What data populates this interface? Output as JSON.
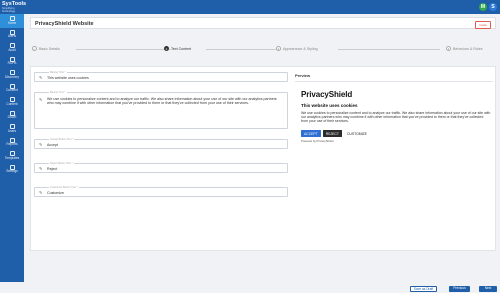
{
  "brand": {
    "name": "SysTools",
    "tagline": "Simplifying Technology"
  },
  "topbar": {
    "avatar_m": "M",
    "avatar_s": "S",
    "avatar_m_color": "#2fa84f",
    "avatar_s_color": "#2f7ad8"
  },
  "sidebar": {
    "items": [
      {
        "label": "Home",
        "icon": "home-icon",
        "active": true
      },
      {
        "label": "Alerts",
        "icon": "bell-icon"
      },
      {
        "label": "Audit",
        "icon": "audit-icon"
      },
      {
        "label": "ROPA",
        "icon": "ropa-icon"
      },
      {
        "label": "Discovery",
        "icon": "discovery-icon"
      },
      {
        "label": "Consent",
        "icon": "consent-icon"
      },
      {
        "label": "Content",
        "icon": "content-icon"
      },
      {
        "label": "DSAR",
        "icon": "dsar-icon"
      },
      {
        "label": "Users",
        "icon": "users-icon"
      },
      {
        "label": "Reports",
        "icon": "reports-icon"
      },
      {
        "label": "Templates",
        "icon": "templates-icon"
      },
      {
        "label": "Settings",
        "icon": "settings-icon"
      }
    ]
  },
  "header": {
    "title": "PrivacyShield Website",
    "badge": "Inside"
  },
  "stepper": {
    "steps": [
      {
        "label": "Basic Details",
        "mark": "✓"
      },
      {
        "label": "Text Content",
        "mark": "2"
      },
      {
        "label": "Appearance & Styling",
        "mark": "3"
      },
      {
        "label": "Behaviors & Rules",
        "mark": "4"
      }
    ]
  },
  "form": {
    "banner_title": {
      "label": "Banner Title *",
      "value": "This website uses cookies"
    },
    "banner_text": {
      "label": "Banner Text *",
      "value": "We use cookies to personalize content and to analyze our traffic. We also share information about your use of our site with our analytics partners who may combine it with other information that you've provided to them or that they've collected from your use of their services."
    },
    "accept_text": {
      "label": "Accept Button Text *",
      "value": "Accept"
    },
    "reject_text": {
      "label": "Reject Button Text *",
      "value": "Reject"
    },
    "customize_text": {
      "label": "Customize Button Text *",
      "value": "Customize"
    }
  },
  "preview": {
    "label": "Preview",
    "logo_text": "PrivacyShield",
    "title": "This website uses cookies",
    "body": "We use cookies to personalize content and to analyze our traffic. We also share information about your use of our site with our analytics partners who may combine it with other information that you've provided to them or that they've collected from your use of their services.",
    "accept": "ACCEPT",
    "reject": "REJECT",
    "customize": "CUSTOMIZE",
    "powered": "Powered by PrivacyShield",
    "accent": "#2d6fd2"
  },
  "footer": {
    "draft": "Save as Draft",
    "previous": "Previous",
    "next": "Next"
  }
}
